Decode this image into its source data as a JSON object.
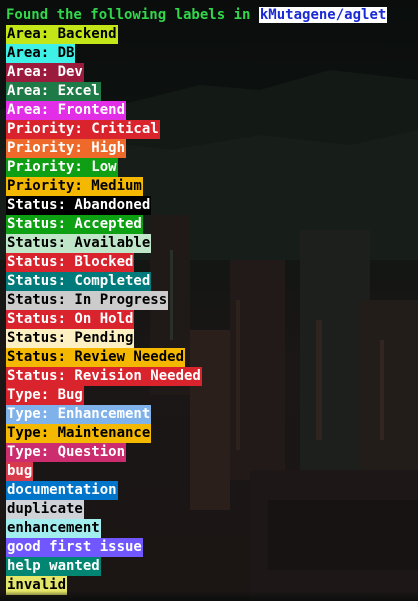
{
  "header": {
    "prefix": "Found the following labels in ",
    "repo": "kMutagene/aglet"
  },
  "labels": [
    {
      "text": "Area: Backend",
      "bg": "#c3e619",
      "fg": "#000000"
    },
    {
      "text": "Area: DB",
      "bg": "#3ef0e6",
      "fg": "#000000"
    },
    {
      "text": "Area: Dev",
      "bg": "#9b1b3c",
      "fg": "#ffffff"
    },
    {
      "text": "Area: Excel",
      "bg": "#1e7a47",
      "fg": "#ffffff"
    },
    {
      "text": "Area: Frontend",
      "bg": "#e22ee6",
      "fg": "#ffffff"
    },
    {
      "text": "Priority: Critical",
      "bg": "#d9232d",
      "fg": "#ffffff"
    },
    {
      "text": "Priority: High",
      "bg": "#ef6a2a",
      "fg": "#ffffff"
    },
    {
      "text": "Priority: Low",
      "bg": "#0e9f14",
      "fg": "#ffffff"
    },
    {
      "text": "Priority: Medium",
      "bg": "#f5b800",
      "fg": "#000000"
    },
    {
      "text": "Status: Abandoned",
      "bg": "#000000",
      "fg": "#ffffff"
    },
    {
      "text": "Status: Accepted",
      "bg": "#0da012",
      "fg": "#ffffff"
    },
    {
      "text": "Status: Available",
      "bg": "#bfe6c8",
      "fg": "#000000"
    },
    {
      "text": "Status: Blocked",
      "bg": "#d9232d",
      "fg": "#ffffff"
    },
    {
      "text": "Status: Completed",
      "bg": "#007a7a",
      "fg": "#ffffff"
    },
    {
      "text": "Status: In Progress",
      "bg": "#cccccc",
      "fg": "#000000"
    },
    {
      "text": "Status: On Hold",
      "bg": "#d9232d",
      "fg": "#ffffff"
    },
    {
      "text": "Status: Pending",
      "bg": "#fdf0c2",
      "fg": "#000000"
    },
    {
      "text": "Status: Review Needed",
      "bg": "#f5b800",
      "fg": "#000000"
    },
    {
      "text": "Status: Revision Needed",
      "bg": "#d9232d",
      "fg": "#ffffff"
    },
    {
      "text": "Type: Bug",
      "bg": "#d9232d",
      "fg": "#ffffff"
    },
    {
      "text": "Type: Enhancement",
      "bg": "#7fb2ea",
      "fg": "#ffffff"
    },
    {
      "text": "Type: Maintenance",
      "bg": "#f5b800",
      "fg": "#000000"
    },
    {
      "text": "Type: Question",
      "bg": "#cc2d6f",
      "fg": "#ffffff"
    },
    {
      "text": "bug",
      "bg": "#d73a4a",
      "fg": "#ffffff"
    },
    {
      "text": "documentation",
      "bg": "#0075ca",
      "fg": "#ffffff"
    },
    {
      "text": "duplicate",
      "bg": "#cfd3d7",
      "fg": "#000000"
    },
    {
      "text": "enhancement",
      "bg": "#a2eeef",
      "fg": "#000000"
    },
    {
      "text": "good first issue",
      "bg": "#7057ff",
      "fg": "#ffffff"
    },
    {
      "text": "help wanted",
      "bg": "#008672",
      "fg": "#ffffff"
    },
    {
      "text": "invalid",
      "bg": "#e4e669",
      "fg": "#000000"
    }
  ]
}
